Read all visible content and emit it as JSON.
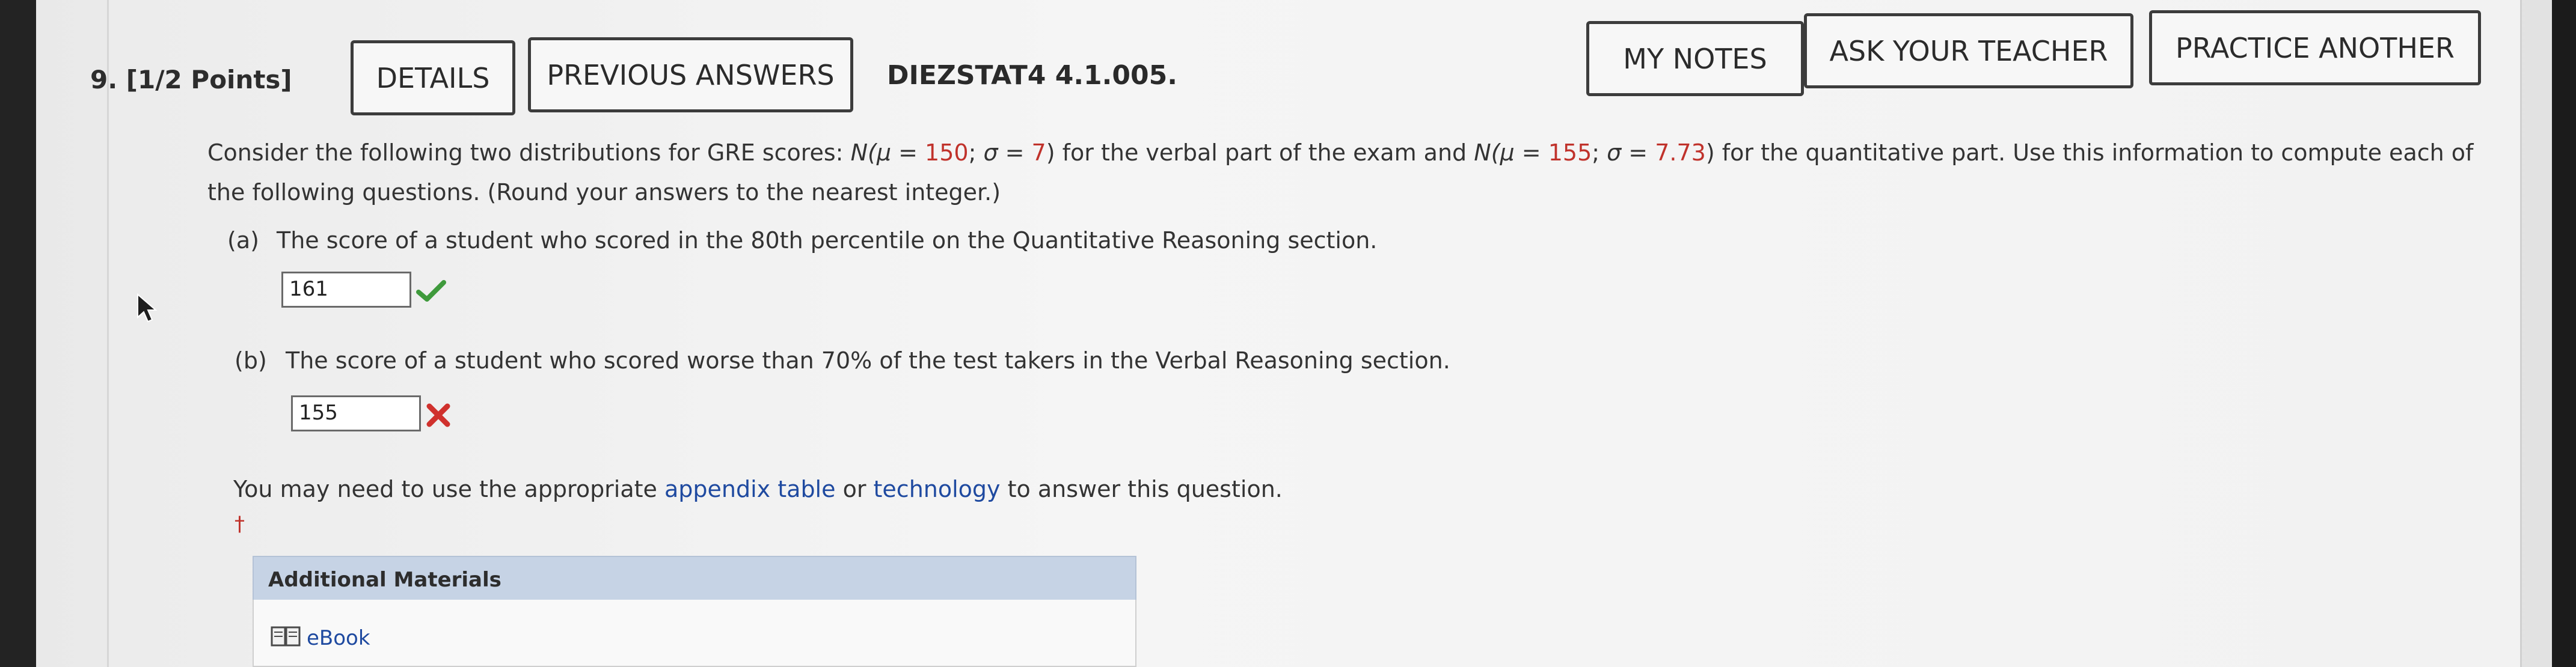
{
  "question": {
    "number_points": "9. [1/2 Points]",
    "code": "DIEZSTAT4 4.1.005."
  },
  "buttons": {
    "details": "DETAILS",
    "previous_answers": "PREVIOUS ANSWERS",
    "my_notes": "MY NOTES",
    "ask_teacher": "ASK YOUR TEACHER",
    "practice_another": "PRACTICE ANOTHER"
  },
  "intro": {
    "t1": "Consider the following two distributions for GRE scores: ",
    "n1": "N(",
    "mu1_label": "μ = ",
    "mu1": "150",
    "sep1": "; ",
    "sigma1_label": "σ = ",
    "sigma1": "7",
    "t2": ") for the verbal part of the exam and ",
    "n2": "N(",
    "mu2_label": "μ = ",
    "mu2": "155",
    "sep2": "; ",
    "sigma2_label": "σ = ",
    "sigma2": "7.73",
    "t3": ") for the quantitative part. Use this information to compute each of",
    "line2": "the following questions. (Round your answers to the nearest integer.)"
  },
  "part_a": {
    "label": "(a)",
    "text": "The score of a student who scored in the 80th percentile on the Quantitative Reasoning section.",
    "answer": "161",
    "status": "correct"
  },
  "part_b": {
    "label": "(b)",
    "text": "The score of a student who scored worse than 70% of the test takers in the Verbal Reasoning section.",
    "answer": "155",
    "status": "incorrect"
  },
  "help": {
    "t1": "You may need to use the appropriate ",
    "link1": "appendix table",
    "t2": " or ",
    "link2": "technology",
    "t3": " to answer this question.",
    "dagger": "†"
  },
  "additional_materials": {
    "title": "Additional Materials",
    "ebook": "eBook"
  },
  "colors": {
    "correct": "#3f9a3c",
    "incorrect": "#d0312d",
    "link": "#1f4aa0",
    "given_value": "#c0322b"
  }
}
